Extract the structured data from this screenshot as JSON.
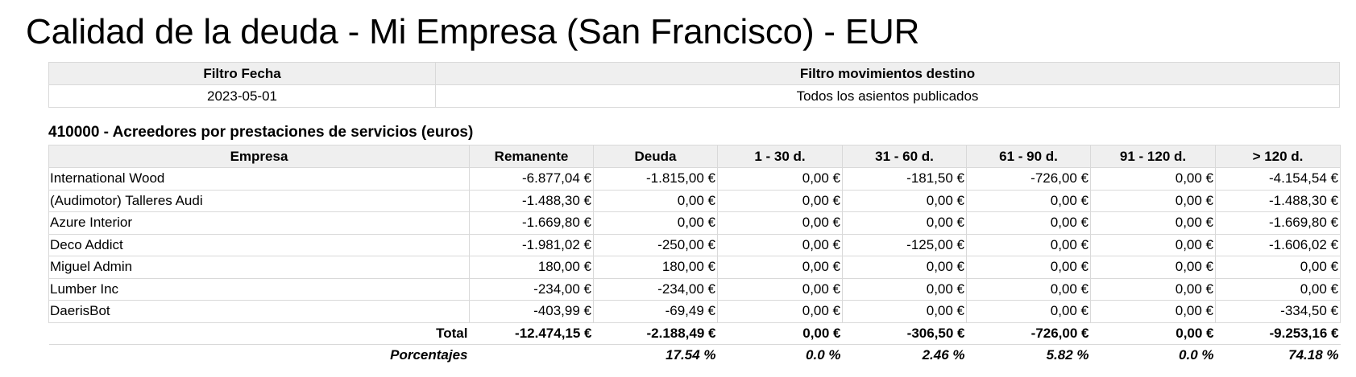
{
  "title": "Calidad de la deuda - Mi Empresa (San Francisco) - EUR",
  "filters": {
    "date_label": "Filtro Fecha",
    "moves_label": "Filtro movimientos destino",
    "date_value": "2023-05-01",
    "moves_value": "Todos los asientos publicados"
  },
  "section_title": "410000 - Acreedores por prestaciones de servicios (euros)",
  "table": {
    "headers": [
      "Empresa",
      "Remanente",
      "Deuda",
      "1 - 30 d.",
      "31 - 60 d.",
      "61 - 90 d.",
      "91 - 120 d.",
      "> 120 d."
    ],
    "rows": [
      [
        "International Wood",
        "-6.877,04 €",
        "-1.815,00 €",
        "0,00 €",
        "-181,50 €",
        "-726,00 €",
        "0,00 €",
        "-4.154,54 €"
      ],
      [
        "(Audimotor) Talleres Audi",
        "-1.488,30 €",
        "0,00 €",
        "0,00 €",
        "0,00 €",
        "0,00 €",
        "0,00 €",
        "-1.488,30 €"
      ],
      [
        "Azure Interior",
        "-1.669,80 €",
        "0,00 €",
        "0,00 €",
        "0,00 €",
        "0,00 €",
        "0,00 €",
        "-1.669,80 €"
      ],
      [
        "Deco Addict",
        "-1.981,02 €",
        "-250,00 €",
        "0,00 €",
        "-125,00 €",
        "0,00 €",
        "0,00 €",
        "-1.606,02 €"
      ],
      [
        "Miguel Admin",
        "180,00 €",
        "180,00 €",
        "0,00 €",
        "0,00 €",
        "0,00 €",
        "0,00 €",
        "0,00 €"
      ],
      [
        "Lumber Inc",
        "-234,00 €",
        "-234,00 €",
        "0,00 €",
        "0,00 €",
        "0,00 €",
        "0,00 €",
        "0,00 €"
      ],
      [
        "DaerisBot",
        "-403,99 €",
        "-69,49 €",
        "0,00 €",
        "0,00 €",
        "0,00 €",
        "0,00 €",
        "-334,50 €"
      ]
    ],
    "total": [
      "Total",
      "-12.474,15 €",
      "-2.188,49 €",
      "0,00 €",
      "-306,50 €",
      "-726,00 €",
      "0,00 €",
      "-9.253,16 €"
    ],
    "percentages": [
      "Porcentajes",
      "",
      "17.54 %",
      "0.0 %",
      "2.46 %",
      "5.82 %",
      "0.0 %",
      "74.18 %"
    ]
  }
}
